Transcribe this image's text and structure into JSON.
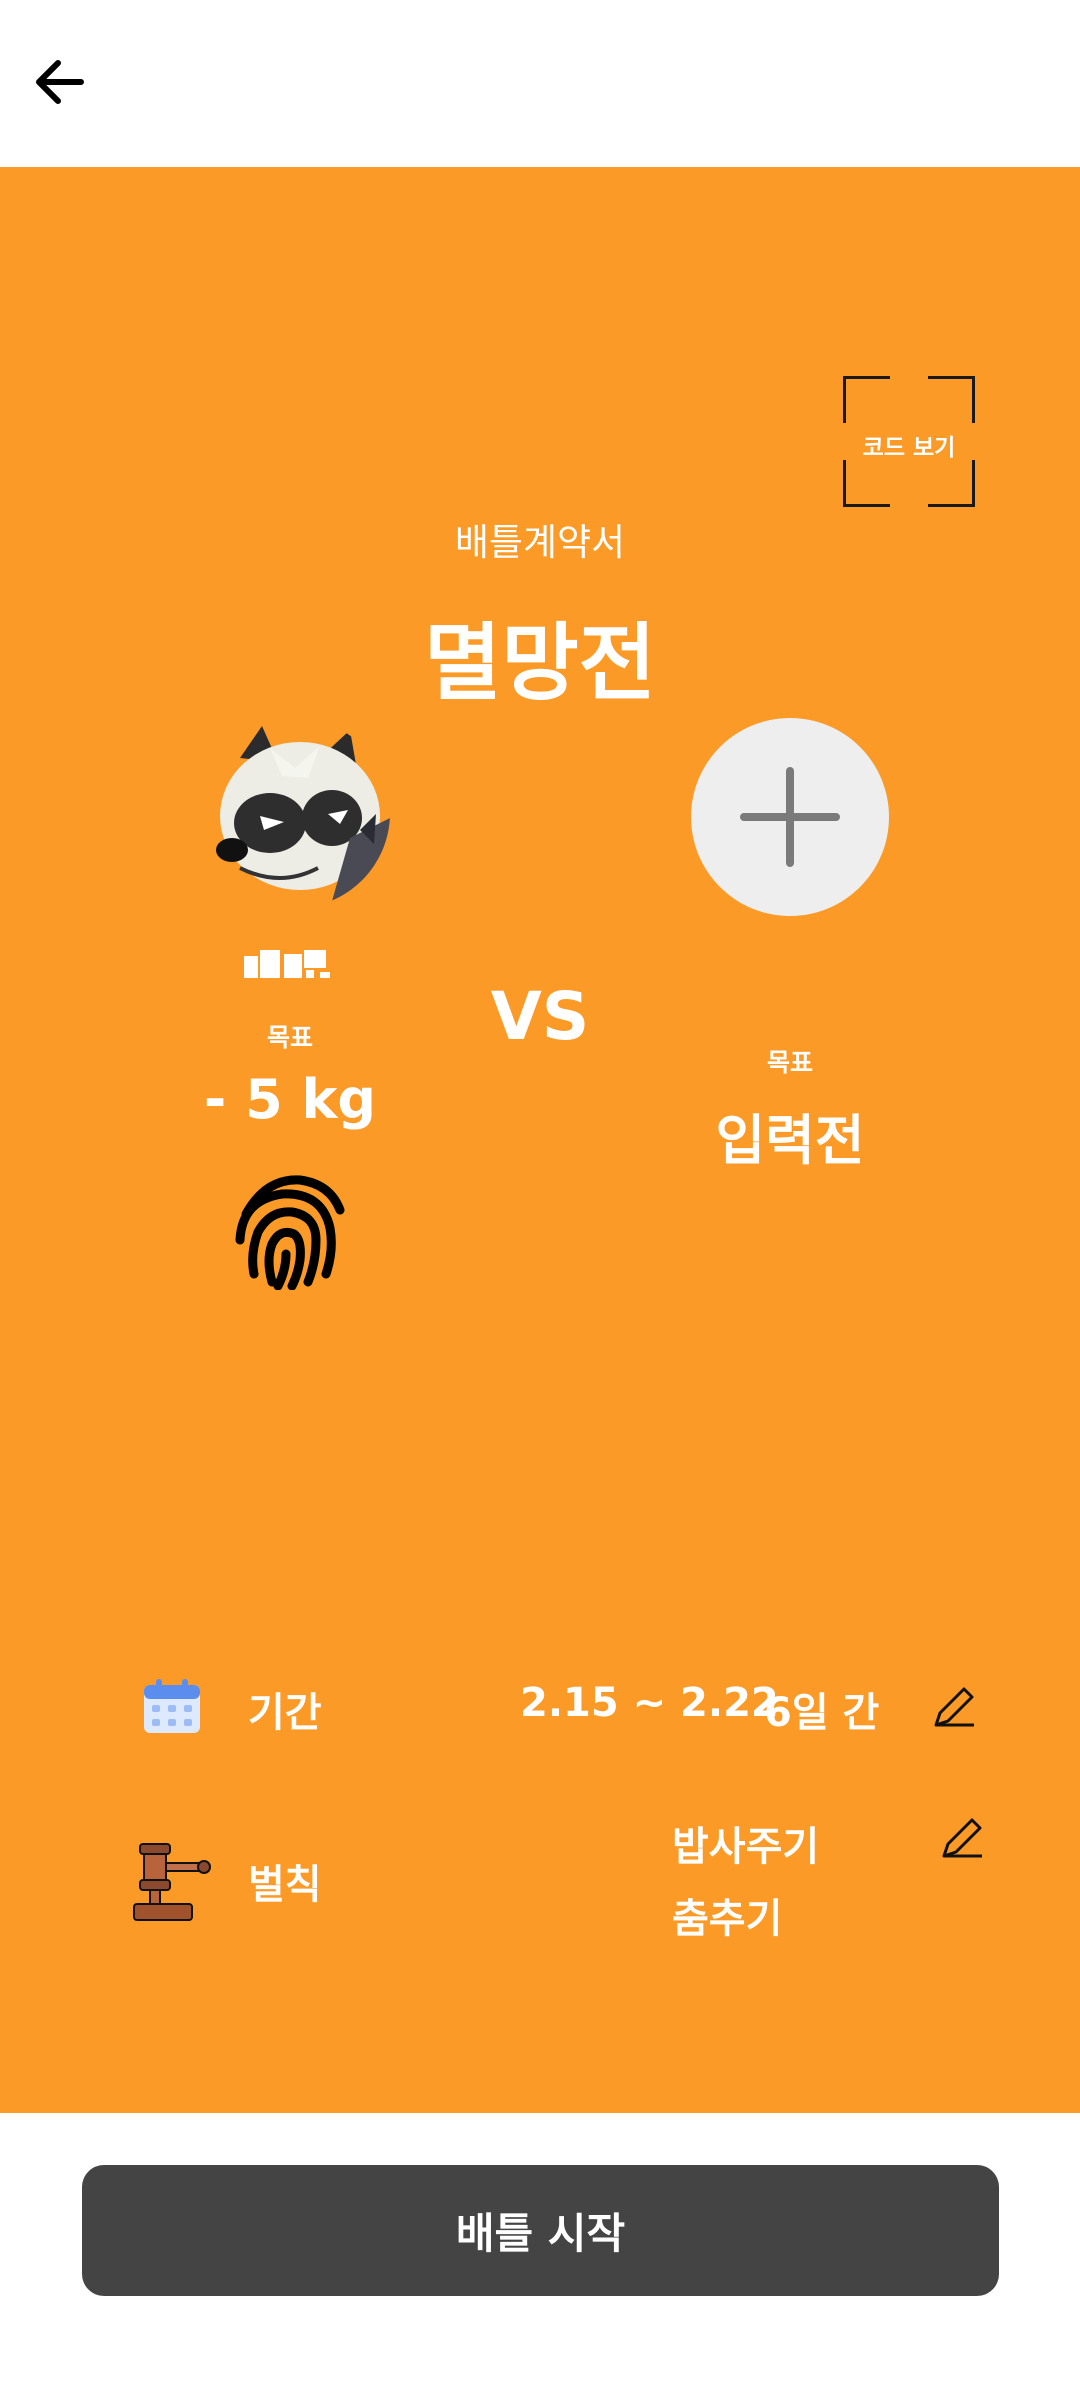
{
  "header": {
    "back_icon": "arrow-left-icon"
  },
  "contract": {
    "code_button_label": "코드 보기",
    "subtitle": "배틀계약서",
    "title": "멸망전"
  },
  "player": {
    "avatar_icon": "pancham-avatar",
    "goal_label": "목표",
    "goal_value": "- 5 kg",
    "signature_icon": "fingerprint-icon"
  },
  "vs_label": "VS",
  "opponent": {
    "add_icon": "plus-icon",
    "goal_label": "목표",
    "goal_value": "입력전"
  },
  "period": {
    "icon": "calendar-icon",
    "label": "기간",
    "range": "2.15 ~ 2.22",
    "duration": "6일 간",
    "edit_icon": "pencil-icon"
  },
  "penalty": {
    "icon": "gavel-icon",
    "label": "벌칙",
    "items": [
      "밥사주기",
      "춤추기"
    ],
    "edit_icon": "pencil-icon"
  },
  "start_button_label": "배틀 시작",
  "colors": {
    "panel": "#FB9A27",
    "button": "#444444",
    "add_circle": "#EEEEEE"
  }
}
